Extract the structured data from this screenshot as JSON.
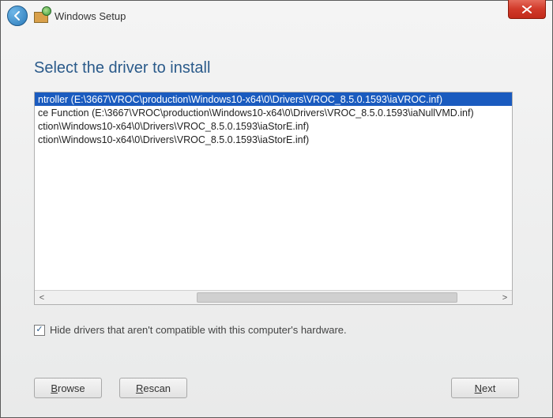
{
  "window": {
    "title": "Windows Setup"
  },
  "heading": "Select the driver to install",
  "drivers": [
    {
      "text": "ntroller (E:\\3667\\VROC\\production\\Windows10-x64\\0\\Drivers\\VROC_8.5.0.1593\\iaVROC.inf)",
      "selected": true
    },
    {
      "text": "ce Function (E:\\3667\\VROC\\production\\Windows10-x64\\0\\Drivers\\VROC_8.5.0.1593\\iaNullVMD.inf)",
      "selected": false
    },
    {
      "text": "ction\\Windows10-x64\\0\\Drivers\\VROC_8.5.0.1593\\iaStorE.inf)",
      "selected": false
    },
    {
      "text": "ction\\Windows10-x64\\0\\Drivers\\VROC_8.5.0.1593\\iaStorE.inf)",
      "selected": false
    }
  ],
  "checkbox": {
    "label": "Hide drivers that aren't compatible with this computer's hardware.",
    "checked": true
  },
  "buttons": {
    "browse": {
      "mnemonic": "B",
      "rest": "rowse"
    },
    "rescan": {
      "mnemonic": "R",
      "rest": "escan"
    },
    "next": {
      "mnemonic": "N",
      "rest": "ext"
    }
  },
  "scroll": {
    "left_glyph": "<",
    "right_glyph": ">"
  }
}
